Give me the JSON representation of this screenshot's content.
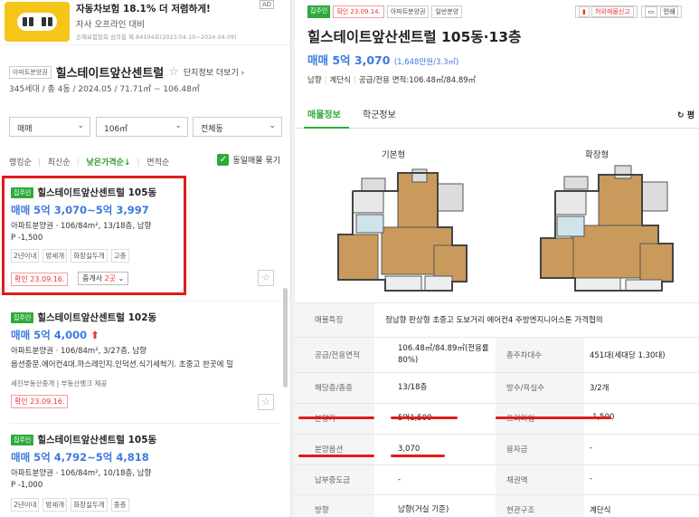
{
  "ad": {
    "title": "자동차보험 18.1% 더 저렴하게!",
    "subtitle": "자사 오프라인 대비",
    "caption": "손해보험협회 심의필 제 84104호(2023.04.10~2024.04.09)",
    "badge": "AD",
    "image_icon": "car-image"
  },
  "complex": {
    "type_tag": "아파트분양권",
    "name": "힐스테이트앞산센트럴",
    "more_label": "단지정보 더보기",
    "info": "345세대 / 총 4동 / 2024.05 / 71.71㎡ ~ 106.48㎡"
  },
  "filters": [
    {
      "value": "매매"
    },
    {
      "value": "106㎡"
    },
    {
      "value": "전체동"
    }
  ],
  "sort": {
    "options": [
      "랭킹순",
      "최신순",
      "낮은가격순↓",
      "면적순"
    ],
    "active_index": 2,
    "same_listing_label": "동일매물 묶기",
    "same_listing_checked": true
  },
  "listings": [
    {
      "badge": "집주인",
      "name": "힐스테이트앞산센트럴 105동",
      "price": "매매 5억 3,070~5억 3,997",
      "meta": "아파트분양권 · 106/84m², 13/18층, 남향",
      "premium": "P -1,500",
      "tags": [
        "2년이내",
        "방세개",
        "화장실두개",
        "고층"
      ],
      "confirm": "확인 23.09.16.",
      "broker": "중개사 ",
      "broker_count": "2곳",
      "highlighted": true
    },
    {
      "badge": "집주인",
      "name": "힐스테이트앞산센트럴 102동",
      "price": "매매 5억 4,000",
      "meta": "아파트분양권 · 106/84m², 3/27층, 남향",
      "desc": "옵션중문.에어컨4대.까스레인지.인덕션.식기세척기. 초중고 한곳에 밀",
      "notes": "세진부동산중개 | 부동산뱅크 제공",
      "confirm": "확인 23.09.16."
    },
    {
      "badge": "집주인",
      "name": "힐스테이트앞산센트럴 105동",
      "price": "매매 5억 4,792~5억 4,818",
      "meta": "아파트분양권 · 106/84m², 10/18층, 남향",
      "premium": "P -1,000",
      "tags": [
        "2년이내",
        "방세개",
        "화장실두개",
        "중층"
      ]
    }
  ],
  "detail": {
    "tags": [
      "집주인",
      "확인 23.09.14.",
      "아파트분양권",
      "일반분양"
    ],
    "report_label": "허위매물신고",
    "print_label": "인쇄",
    "title": "힐스테이트앞산센트럴 105동·13층",
    "price": "매매 5억 3,070",
    "price_sub": "(1,648만원/3.3㎡)",
    "spec": [
      "남향",
      "계단식",
      "공급/전용 면적:106.48㎡/84.89㎡"
    ],
    "tabs": [
      "매물정보",
      "학군정보"
    ],
    "tab_extra": "평",
    "floorplans": [
      "기본형",
      "확장형"
    ],
    "feature_label": "매물특징",
    "feature_value": "정남향 판상형 초중고 도보거리 에어컨4 주방엔지니어스톤 가격협의",
    "rows": [
      {
        "l1": "공급/전용면적",
        "v1": "106.48㎡/84.89㎡(전용률80%)",
        "l2": "총주차대수",
        "v2": "451대(세대당 1.30대)"
      },
      {
        "l1": "해당층/총층",
        "v1": "13/18층",
        "l2": "방수/욕실수",
        "v2": "3/2개"
      },
      {
        "l1": "분양가",
        "v1": "5억1,500",
        "l2": "프리미엄",
        "v2": "-1,500"
      },
      {
        "l1": "분양옵션",
        "v1": "3,070",
        "l2": "융자금",
        "v2": "-"
      },
      {
        "l1": "납부중도금",
        "v1": "-",
        "l2": "채권액",
        "v2": "-"
      },
      {
        "l1": "방향",
        "v1": "남향(거실 기준)",
        "l2": "현관구조",
        "v2": "계단식"
      }
    ]
  },
  "colors": {
    "green": "#2eaa3d",
    "blue_price": "#3b7ae0",
    "red_highlight": "#e31b1b"
  }
}
